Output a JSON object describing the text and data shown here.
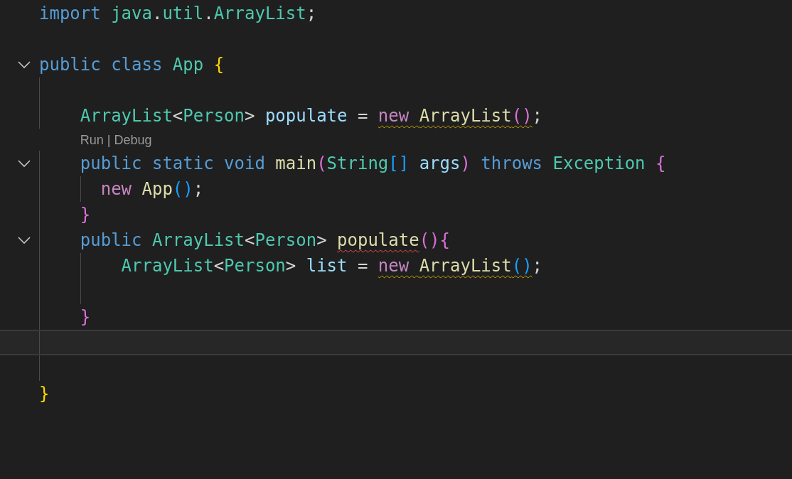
{
  "editor": {
    "lines": [
      {
        "kind": "code",
        "current": false,
        "tokens": [
          {
            "t": "import ",
            "kind": "keyword"
          },
          {
            "t": "java",
            "kind": "type"
          },
          {
            "t": ".",
            "kind": "plain"
          },
          {
            "t": "util",
            "kind": "type"
          },
          {
            "t": ".",
            "kind": "plain"
          },
          {
            "t": "ArrayList",
            "kind": "type"
          },
          {
            "t": ";",
            "kind": "plain"
          }
        ]
      },
      {
        "kind": "code",
        "current": false
      },
      {
        "kind": "code",
        "current": false,
        "expanded": true,
        "tokens": [
          {
            "t": "public ",
            "kind": "keyword"
          },
          {
            "t": "class ",
            "kind": "keyword"
          },
          {
            "t": "App ",
            "kind": "type"
          },
          {
            "t": "{",
            "kind": "bracket1"
          }
        ]
      },
      {
        "kind": "code",
        "current": false
      },
      {
        "kind": "code",
        "current": false,
        "tokens": [
          {
            "t": "    ArrayList",
            "kind": "type"
          },
          {
            "t": "<",
            "kind": "plain"
          },
          {
            "t": "Person",
            "kind": "type"
          },
          {
            "t": "> ",
            "kind": "plain"
          },
          {
            "t": "populate",
            "kind": "variable"
          },
          {
            "t": " = ",
            "kind": "plain"
          },
          {
            "kind": "warning",
            "tokens": [
              {
                "t": "new ",
                "kind": "control"
              },
              {
                "t": "ArrayList",
                "kind": "function"
              },
              {
                "t": "()",
                "kind": "bracket2"
              }
            ]
          },
          {
            "t": ";",
            "kind": "plain"
          }
        ]
      },
      {
        "kind": "codelens",
        "actions": [
          "Run",
          "Debug"
        ],
        "separator": "|"
      },
      {
        "kind": "code",
        "current": false,
        "expanded": true,
        "tokens": [
          {
            "t": "    public ",
            "kind": "keyword"
          },
          {
            "t": "static ",
            "kind": "keyword"
          },
          {
            "t": "void ",
            "kind": "keyword"
          },
          {
            "t": "main",
            "kind": "function"
          },
          {
            "t": "(",
            "kind": "bracket2"
          },
          {
            "t": "String",
            "kind": "type"
          },
          {
            "t": "[]",
            "kind": "bracket3"
          },
          {
            "t": " args",
            "kind": "variable"
          },
          {
            "t": ")",
            "kind": "bracket2"
          },
          {
            "t": " throws ",
            "kind": "keyword"
          },
          {
            "t": "Exception ",
            "kind": "type"
          },
          {
            "t": "{",
            "kind": "bracket2"
          }
        ]
      },
      {
        "kind": "code",
        "current": false,
        "tokens": [
          {
            "t": "      new ",
            "kind": "control"
          },
          {
            "t": "App",
            "kind": "function"
          },
          {
            "t": "()",
            "kind": "bracket3"
          },
          {
            "t": ";",
            "kind": "plain"
          }
        ]
      },
      {
        "kind": "code",
        "current": false,
        "tokens": [
          {
            "t": "    }",
            "kind": "bracket2"
          }
        ]
      },
      {
        "kind": "code",
        "current": false,
        "expanded": true,
        "tokens": [
          {
            "t": "    public ",
            "kind": "keyword"
          },
          {
            "t": "ArrayList",
            "kind": "type"
          },
          {
            "t": "<",
            "kind": "plain"
          },
          {
            "t": "Person",
            "kind": "type"
          },
          {
            "t": "> ",
            "kind": "plain"
          },
          {
            "kind": "error",
            "tokens": [
              {
                "t": "populate",
                "kind": "function"
              }
            ]
          },
          {
            "t": "()",
            "kind": "bracket2"
          },
          {
            "t": "{",
            "kind": "bracket2"
          }
        ]
      },
      {
        "kind": "code",
        "current": false,
        "tokens": [
          {
            "t": "        ArrayList",
            "kind": "type"
          },
          {
            "t": "<",
            "kind": "plain"
          },
          {
            "t": "Person",
            "kind": "type"
          },
          {
            "t": "> ",
            "kind": "plain"
          },
          {
            "t": "list",
            "kind": "variable"
          },
          {
            "t": " = ",
            "kind": "plain"
          },
          {
            "kind": "warning",
            "tokens": [
              {
                "t": "new ",
                "kind": "control"
              },
              {
                "t": "ArrayList",
                "kind": "function"
              },
              {
                "t": "()",
                "kind": "bracket3"
              }
            ]
          },
          {
            "t": ";",
            "kind": "plain"
          }
        ]
      },
      {
        "kind": "code",
        "current": false
      },
      {
        "kind": "code",
        "current": false,
        "tokens": [
          {
            "t": "    }",
            "kind": "bracket2"
          }
        ]
      },
      {
        "kind": "code",
        "current": true
      },
      {
        "kind": "code",
        "current": false
      },
      {
        "kind": "code",
        "current": false,
        "tokens": [
          {
            "t": "}",
            "kind": "bracket1"
          }
        ]
      }
    ]
  }
}
